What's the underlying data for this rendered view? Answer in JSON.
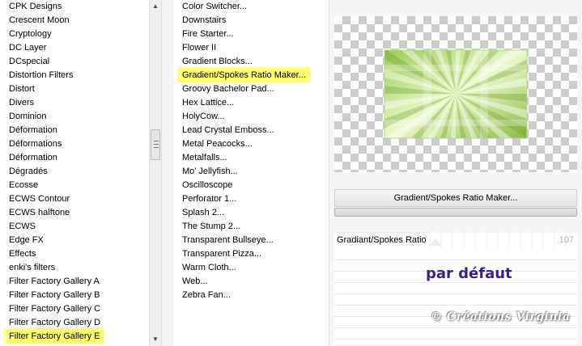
{
  "categories": {
    "items": [
      "CPK Designs",
      "Crescent Moon",
      "Cryptology",
      "DC Layer",
      "DCspecial",
      "Distortion Filters",
      "Distort",
      "Divers",
      "Dominion",
      "Déformation",
      "Déformations",
      "Déformation",
      "Dégradés",
      "Ecosse",
      "ECWS Contour",
      "ECWS halftone",
      "ECWS",
      "Edge FX",
      "Effects",
      "enki's filters",
      "Filter Factory Gallery A",
      "Filter Factory Gallery B",
      "Filter Factory Gallery C",
      "Filter Factory Gallery D",
      "Filter Factory Gallery E"
    ],
    "selected_index": 24
  },
  "filters": {
    "items": [
      "Color Switcher...",
      "Downstairs",
      "Fire Starter...",
      "Flower II",
      "Gradient Blocks...",
      "Gradient/Spokes Ratio Maker...",
      "Groovy Bachelor Pad...",
      "Hex Lattice...",
      "HolyCow...",
      "Lead Crystal Emboss...",
      "Metal Peacocks...",
      "Metalfalls...",
      "Mo' Jellyfish...",
      "Oscilloscope",
      "Perforator 1...",
      "Splash 2...",
      "The Stump 2...",
      "Transparent Bullseye...",
      "Transparent Pizza...",
      "Warm Cloth...",
      "Web...",
      "Zebra Fan..."
    ],
    "selected_index": 5
  },
  "preview": {
    "filter_button_label": "Gradient/Spokes Ratio Maker..."
  },
  "parameter": {
    "label": "Gradiant/Spokes Ratio",
    "value": "107"
  },
  "overlay": {
    "default_text": "par défaut",
    "watermark": "© Créations Virginia"
  },
  "colors": {
    "selection_highlight": "#ffff66",
    "default_text": "#3a1f8a",
    "preview_green_light": "#e8f7c0",
    "preview_green_dark": "#7fa83a"
  }
}
